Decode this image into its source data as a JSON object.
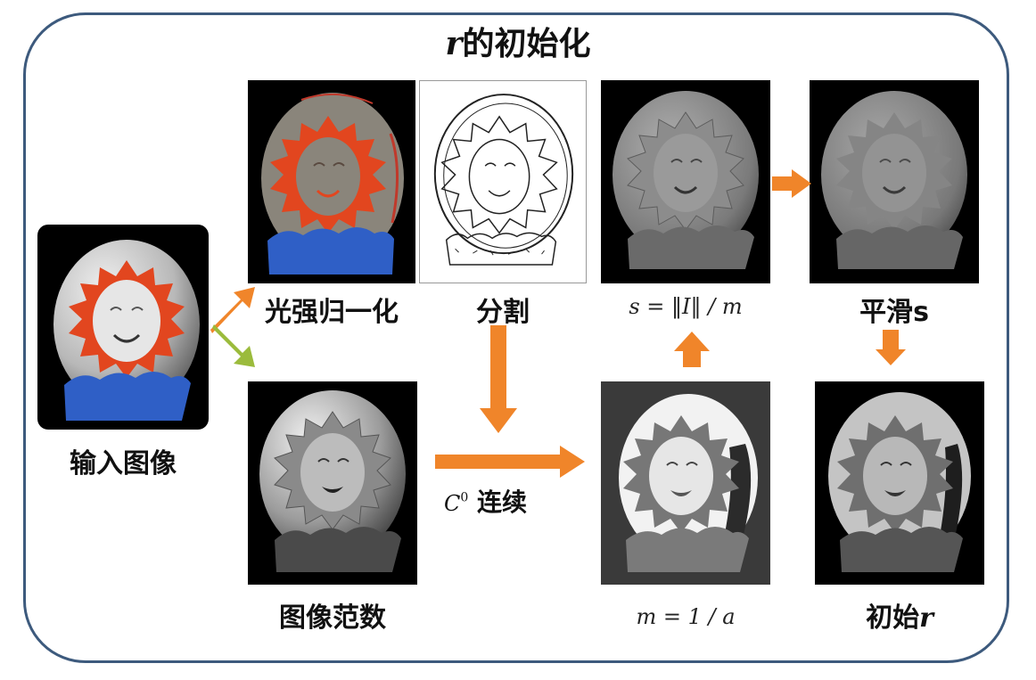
{
  "title": {
    "var": "r",
    "text": "的初始化"
  },
  "nodes": {
    "input": {
      "label": "输入图像"
    },
    "light_norm": {
      "label": "光强归一化"
    },
    "segmentation": {
      "label": "分割"
    },
    "image_norm": {
      "label": "图像范数"
    },
    "s_formula": {
      "label": "s = ‖I‖ / m"
    },
    "smooth_s": {
      "label_text": "平滑",
      "label_var": "s"
    },
    "m_formula": {
      "label": "m = 1 / a"
    },
    "init_r": {
      "label_text": "初始",
      "label_var": "r"
    }
  },
  "edges": {
    "continuity": {
      "label_sym": "C",
      "label_sup": "0",
      "label_text": " 连续"
    }
  },
  "colors": {
    "arrow": "#f0852a",
    "arrow_green": "#9bbb3c",
    "frame": "#3d5a7d",
    "red": "#e2461f",
    "blue": "#2f5fc6"
  }
}
